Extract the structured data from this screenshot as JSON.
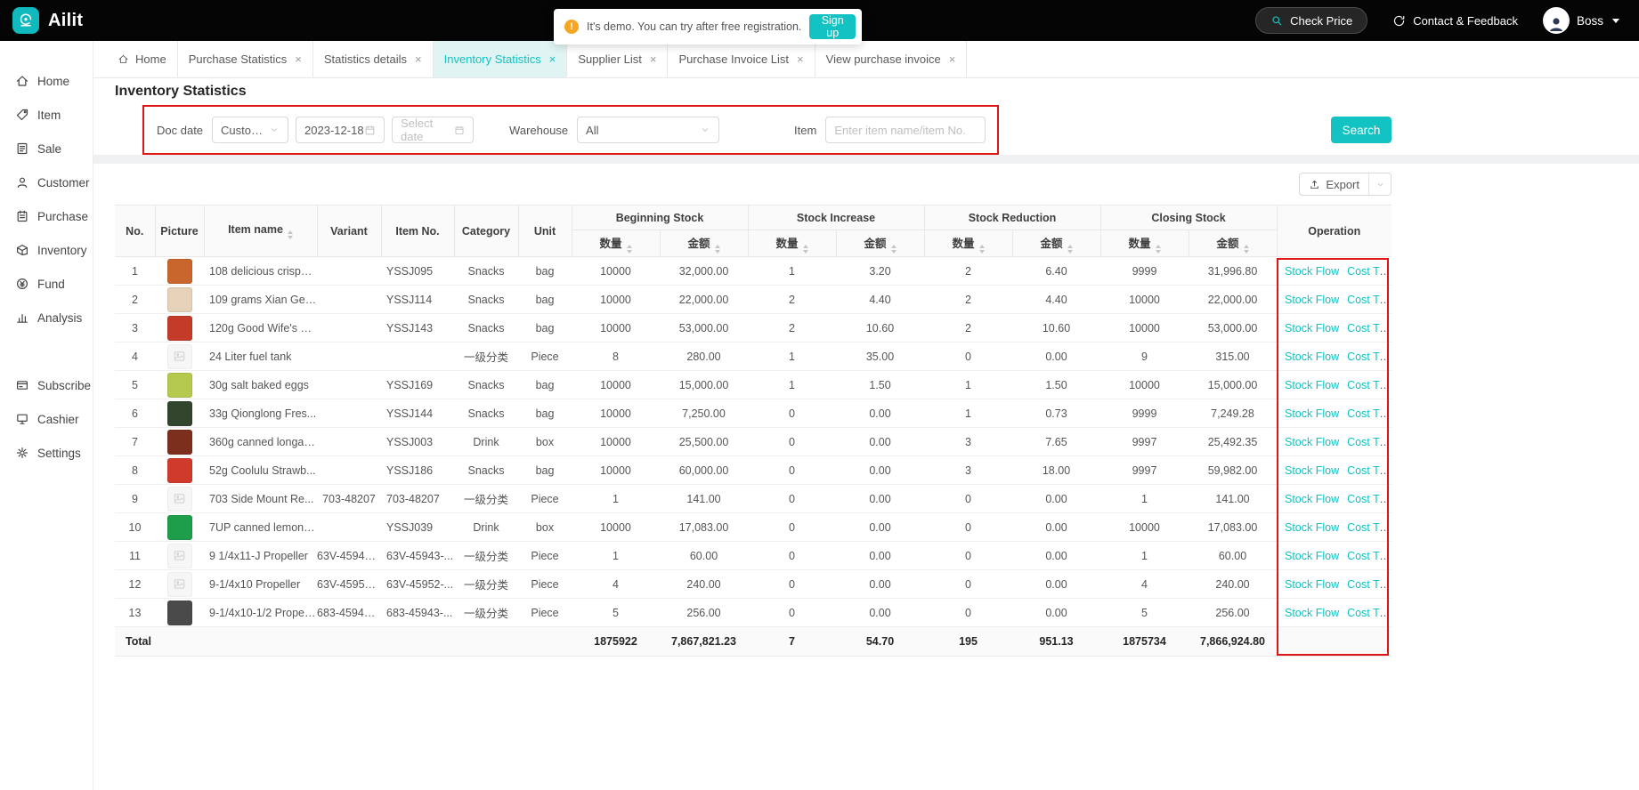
{
  "topbar": {
    "logo_text": "Ailit",
    "demo_notice": "It's demo. You can try after free registration.",
    "signup_label": "Sign up",
    "check_price_label": "Check Price",
    "contact_label": "Contact & Feedback",
    "user_label": "Boss"
  },
  "colors": {
    "accent": "#13c2c2",
    "annotation": "#e01515",
    "warning": "#f5a623",
    "topbar_bg": "#050505"
  },
  "sidebar": {
    "primary": [
      {
        "label": "Home",
        "icon": "home"
      },
      {
        "label": "Item",
        "icon": "item"
      },
      {
        "label": "Sale",
        "icon": "sale"
      },
      {
        "label": "Customer",
        "icon": "customer"
      },
      {
        "label": "Purchase",
        "icon": "purchase"
      },
      {
        "label": "Inventory",
        "icon": "inventory"
      },
      {
        "label": "Fund",
        "icon": "fund"
      },
      {
        "label": "Analysis",
        "icon": "analysis"
      }
    ],
    "secondary": [
      {
        "label": "Subscribe",
        "icon": "subscribe"
      },
      {
        "label": "Cashier",
        "icon": "cashier"
      },
      {
        "label": "Settings",
        "icon": "settings"
      }
    ]
  },
  "tabs": [
    {
      "label": "Home",
      "icon": "home",
      "closable": false,
      "active": false
    },
    {
      "label": "Purchase Statistics",
      "closable": true,
      "active": false
    },
    {
      "label": "Statistics details",
      "closable": true,
      "active": false
    },
    {
      "label": "Inventory Statistics",
      "closable": true,
      "active": true
    },
    {
      "label": "Supplier List",
      "closable": true,
      "active": false
    },
    {
      "label": "Purchase Invoice List",
      "closable": true,
      "active": false
    },
    {
      "label": "View purchase invoice",
      "closable": true,
      "active": false
    }
  ],
  "page": {
    "title": "Inventory Statistics"
  },
  "filters": {
    "doc_date_label": "Doc date",
    "date_mode": "Custom...",
    "date_from": "2023-12-18",
    "date_to_placeholder": "Select date",
    "warehouse_label": "Warehouse",
    "warehouse_value": "All",
    "item_label": "Item",
    "item_placeholder": "Enter item name/item No.",
    "search_label": "Search"
  },
  "toolbar": {
    "export_label": "Export"
  },
  "table": {
    "head": {
      "no": "No.",
      "picture": "Picture",
      "item_name": "Item name",
      "variant": "Variant",
      "item_no": "Item No.",
      "category": "Category",
      "unit": "Unit",
      "operation": "Operation",
      "groups": [
        "Beginning Stock",
        "Stock Increase",
        "Stock Reduction",
        "Closing Stock"
      ],
      "qty": "数量",
      "amount": "金额"
    },
    "ops": [
      "Stock Flow",
      "Cost Tr..."
    ],
    "rows": [
      {
        "no": "1",
        "thumb": "#c9662e",
        "name": "108 delicious crispy ...",
        "variant": "",
        "item_no": "YSSJ095",
        "category": "Snacks",
        "unit": "bag",
        "values": [
          "10000",
          "32,000.00",
          "1",
          "3.20",
          "2",
          "6.40",
          "9999",
          "31,996.80"
        ]
      },
      {
        "no": "2",
        "thumb": "#e6d2b8",
        "name": "109 grams Xian Ge ...",
        "variant": "",
        "item_no": "YSSJ114",
        "category": "Snacks",
        "unit": "bag",
        "values": [
          "10000",
          "22,000.00",
          "2",
          "4.40",
          "2",
          "4.40",
          "10000",
          "22,000.00"
        ]
      },
      {
        "no": "3",
        "thumb": "#c43b2a",
        "name": "120g Good Wife's S...",
        "variant": "",
        "item_no": "YSSJ143",
        "category": "Snacks",
        "unit": "bag",
        "values": [
          "10000",
          "53,000.00",
          "2",
          "10.60",
          "2",
          "10.60",
          "10000",
          "53,000.00"
        ]
      },
      {
        "no": "4",
        "thumb": "placeholder",
        "name": "24 Liter fuel tank",
        "variant": "",
        "item_no": "",
        "category": "一级分类",
        "unit": "Piece",
        "values": [
          "8",
          "280.00",
          "1",
          "35.00",
          "0",
          "0.00",
          "9",
          "315.00"
        ]
      },
      {
        "no": "5",
        "thumb": "#b5c94e",
        "name": "30g salt baked eggs",
        "variant": "",
        "item_no": "YSSJ169",
        "category": "Snacks",
        "unit": "bag",
        "values": [
          "10000",
          "15,000.00",
          "1",
          "1.50",
          "1",
          "1.50",
          "10000",
          "15,000.00"
        ]
      },
      {
        "no": "6",
        "thumb": "#31452c",
        "name": "33g Qionglong Fres...",
        "variant": "",
        "item_no": "YSSJ144",
        "category": "Snacks",
        "unit": "bag",
        "values": [
          "10000",
          "7,250.00",
          "0",
          "0.00",
          "1",
          "0.73",
          "9999",
          "7,249.28"
        ]
      },
      {
        "no": "7",
        "thumb": "#7c2f1d",
        "name": "360g canned longan...",
        "variant": "",
        "item_no": "YSSJ003",
        "category": "Drink",
        "unit": "box",
        "values": [
          "10000",
          "25,500.00",
          "0",
          "0.00",
          "3",
          "7.65",
          "9997",
          "25,492.35"
        ]
      },
      {
        "no": "8",
        "thumb": "#d03a2b",
        "name": "52g Coolulu Strawb...",
        "variant": "",
        "item_no": "YSSJ186",
        "category": "Snacks",
        "unit": "bag",
        "values": [
          "10000",
          "60,000.00",
          "0",
          "0.00",
          "3",
          "18.00",
          "9997",
          "59,982.00"
        ]
      },
      {
        "no": "9",
        "thumb": "placeholder",
        "name": "703 Side Mount Re...",
        "variant": "703-48207",
        "item_no": "703-48207",
        "category": "一级分类",
        "unit": "Piece",
        "values": [
          "1",
          "141.00",
          "0",
          "0.00",
          "0",
          "0.00",
          "1",
          "141.00"
        ]
      },
      {
        "no": "10",
        "thumb": "#1e9e4a",
        "name": "7UP canned lemon f...",
        "variant": "",
        "item_no": "YSSJ039",
        "category": "Drink",
        "unit": "box",
        "values": [
          "10000",
          "17,083.00",
          "0",
          "0.00",
          "0",
          "0.00",
          "10000",
          "17,083.00"
        ]
      },
      {
        "no": "11",
        "thumb": "placeholder",
        "name": "9 1/4x11-J Propeller",
        "variant": "63V-45943-...",
        "item_no": "63V-45943-...",
        "category": "一级分类",
        "unit": "Piece",
        "values": [
          "1",
          "60.00",
          "0",
          "0.00",
          "0",
          "0.00",
          "1",
          "60.00"
        ]
      },
      {
        "no": "12",
        "thumb": "placeholder",
        "name": "9-1/4x10 Propeller",
        "variant": "63V-45952-...",
        "item_no": "63V-45952-...",
        "category": "一级分类",
        "unit": "Piece",
        "values": [
          "4",
          "240.00",
          "0",
          "0.00",
          "0",
          "0.00",
          "4",
          "240.00"
        ]
      },
      {
        "no": "13",
        "thumb": "#4a4a4a",
        "name": "9-1/4x10-1/2 Propeller",
        "variant": "683-45943-...",
        "item_no": "683-45943-...",
        "category": "一级分类",
        "unit": "Piece",
        "values": [
          "5",
          "256.00",
          "0",
          "0.00",
          "0",
          "0.00",
          "5",
          "256.00"
        ]
      }
    ],
    "total": {
      "label": "Total",
      "values": [
        "1875922",
        "7,867,821.23",
        "7",
        "54.70",
        "195",
        "951.13",
        "1875734",
        "7,866,924.80"
      ]
    }
  }
}
